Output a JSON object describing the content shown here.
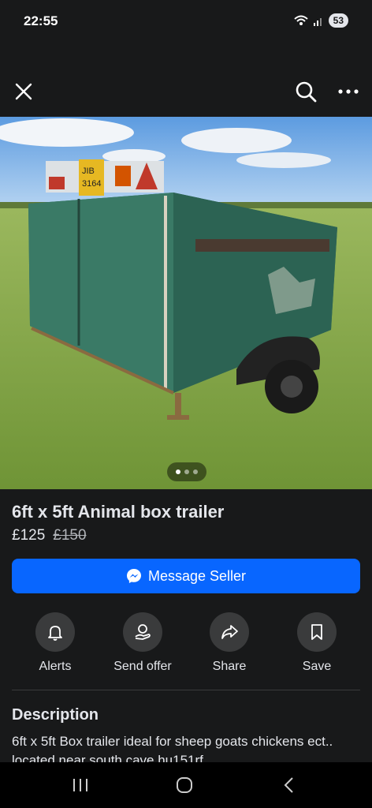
{
  "status_bar": {
    "time": "22:55",
    "battery": "53"
  },
  "top_bar": {
    "close_icon": "close-icon",
    "search_icon": "search-icon",
    "more_icon": "more-icon"
  },
  "photo": {
    "alt": "Green box trailer in a field",
    "page_count": 3,
    "active_page": 1
  },
  "listing": {
    "title": "6ft x 5ft Animal box trailer",
    "price": "£125",
    "old_price": "£150"
  },
  "message_button": {
    "label": "Message Seller"
  },
  "actions": [
    {
      "label": "Alerts",
      "icon": "bell-icon"
    },
    {
      "label": "Send offer",
      "icon": "offer-icon"
    },
    {
      "label": "Share",
      "icon": "share-icon"
    },
    {
      "label": "Save",
      "icon": "bookmark-icon"
    }
  ],
  "description": {
    "heading": "Description",
    "body": "6ft x 5ft Box trailer ideal for sheep goats chickens ect.. located near south cave hu151rf"
  },
  "colors": {
    "accent": "#0866ff",
    "background": "#18191a",
    "circle": "#3a3b3c"
  }
}
